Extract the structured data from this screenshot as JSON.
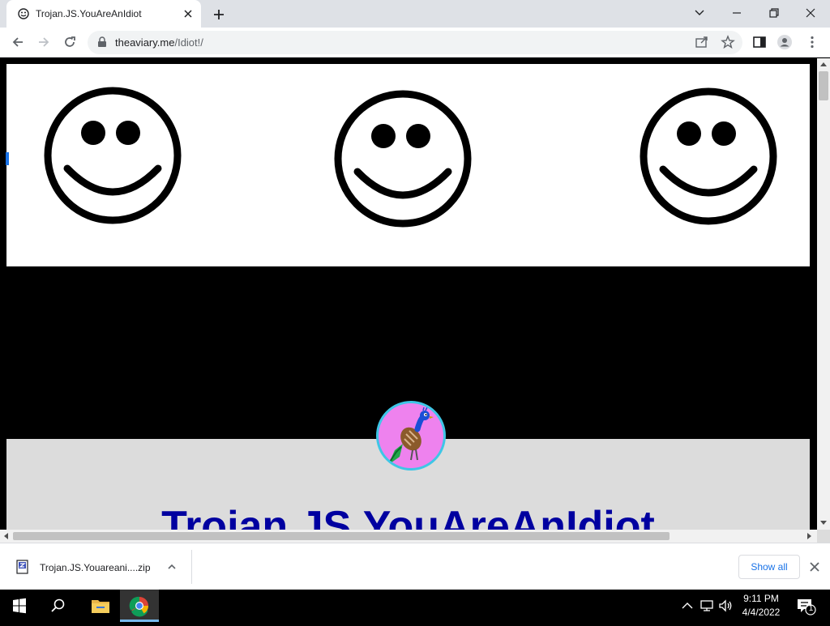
{
  "browser": {
    "tab_title": "Trojan.JS.YouAreAnIdiot",
    "url_domain": "theaviary.me",
    "url_path": "/Idiot!/"
  },
  "page": {
    "title": "Trojan.JS.YouAreAnIdiot",
    "colors": {
      "title": "#0000a0",
      "avatar_bg": "#ee82ee",
      "avatar_ring": "#3ec6e6"
    }
  },
  "downloads": {
    "filename": "Trojan.JS.Youareani....zip",
    "show_all_label": "Show all"
  },
  "taskbar": {
    "time": "9:11 PM",
    "date": "4/4/2022",
    "notification_count": "1"
  },
  "icons": [
    "smiley-favicon-icon",
    "close-icon",
    "plus-icon",
    "chevron-down-icon",
    "minimize-icon",
    "restore-icon",
    "back-arrow-icon",
    "forward-arrow-icon",
    "reload-icon",
    "lock-icon",
    "share-icon",
    "star-icon",
    "side-panel-icon",
    "profile-icon",
    "kebab-menu-icon",
    "zip-file-icon",
    "windows-logo-icon",
    "search-icon",
    "folder-icon",
    "chrome-icon",
    "chevron-up-icon",
    "network-icon",
    "volume-icon",
    "notification-icon"
  ]
}
